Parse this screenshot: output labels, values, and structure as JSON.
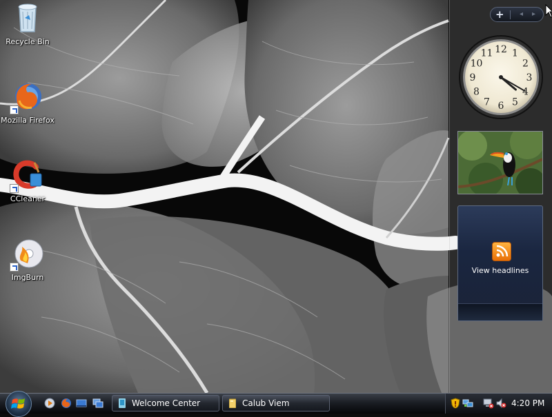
{
  "desktop": {
    "icons": [
      {
        "label": "Recycle Bin",
        "icon": "recycle-bin-icon"
      },
      {
        "label": "Mozilla Firefox",
        "icon": "firefox-icon"
      },
      {
        "label": "CCleaner",
        "icon": "ccleaner-icon"
      },
      {
        "label": "ImgBurn",
        "icon": "imgburn-icon"
      }
    ]
  },
  "sidebar": {
    "toolbar": {
      "add_label": "+",
      "prev_label": "◂",
      "next_label": "▸"
    },
    "clock": {
      "hours": 4,
      "minutes": 20,
      "numerals": [
        "12",
        "1",
        "2",
        "3",
        "4",
        "5",
        "6",
        "7",
        "8",
        "9",
        "10",
        "11"
      ]
    },
    "feed": {
      "caption": "View headlines",
      "icon": "rss-icon"
    }
  },
  "taskbar": {
    "start_icon": "windows-logo-icon",
    "quick_launch": [
      "media-player-icon",
      "firefox-icon",
      "show-desktop-icon",
      "switch-windows-icon"
    ],
    "tasks": [
      {
        "label": "Welcome Center",
        "icon": "welcome-center-icon"
      },
      {
        "label": "Calub Viem",
        "icon": "folder-icon"
      }
    ],
    "tray": {
      "icons": [
        "security-shield-icon",
        "network-icon",
        "network-disconnected-icon",
        "volume-muted-icon"
      ],
      "time": "4:20 PM"
    }
  },
  "colors": {
    "accent": "#e86f06",
    "taskbar": "#1b1e24",
    "sidebar_panel": "#1a2640"
  }
}
